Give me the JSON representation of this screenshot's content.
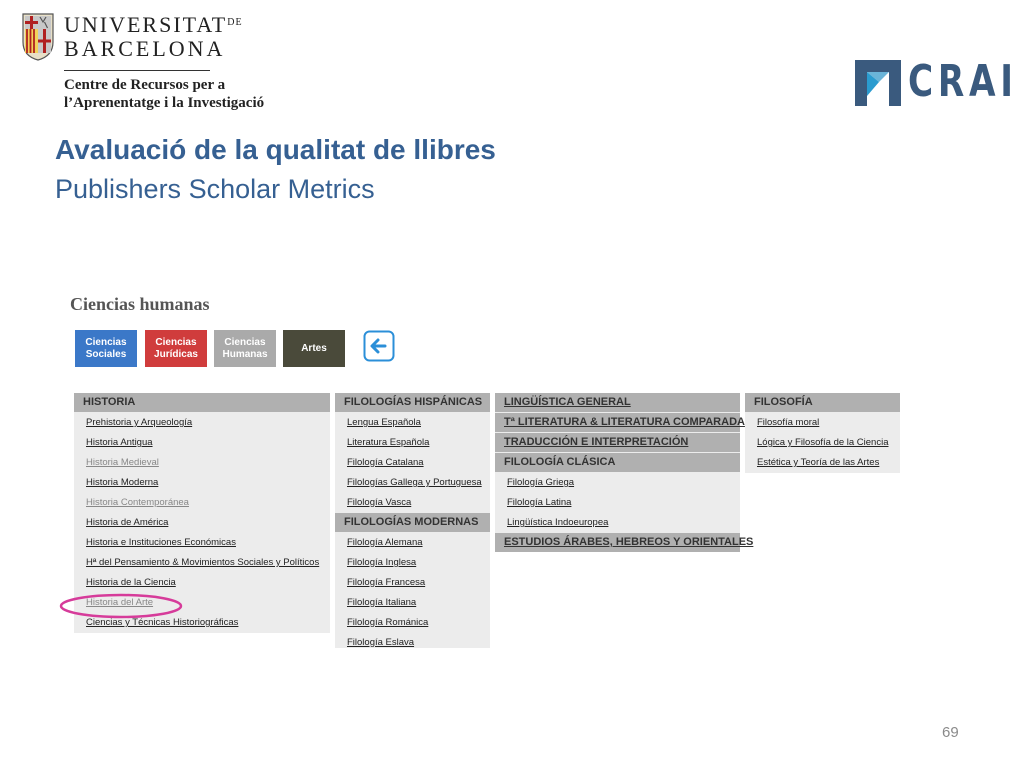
{
  "header": {
    "university_line1_main": "UNIVERSITAT",
    "university_line1_suffix": "DE",
    "university_line2": "BARCELONA",
    "crai_line1": "Centre de Recursos per a",
    "crai_line2": "l’Aprenentatge i la Investigació",
    "crai_logo_text": "CRAI"
  },
  "slide": {
    "title": "Avaluació de la qualitat de llibres",
    "subtitle": "Publishers Scholar Metrics",
    "page_number": "69"
  },
  "colors": {
    "title_blue": "#366092",
    "crai_blue": "#3a5a7e",
    "btn_sociales": "#3b78c8",
    "btn_juridicas": "#d03c3c",
    "btn_humanas": "#aaaaaa",
    "btn_artes": "#4a4a3a",
    "highlight": "#d63b9a"
  },
  "screen": {
    "section_title": "Ciencias humanas",
    "buttons": {
      "sociales": "Ciencias Sociales",
      "juridicas": "Ciencias Jurídicas",
      "humanas": "Ciencias Humanas",
      "artes": "Artes"
    },
    "back_icon": "arrow-left-icon",
    "col1": {
      "head": "HISTORIA",
      "items": [
        "Prehistoria y Arqueología",
        "Historia Antigua",
        "Historia Medieval",
        "Historia Moderna",
        "Historia Contemporánea",
        "Historia de América",
        "Historia e Instituciones Económicas",
        "Hª del Pensamiento & Movimientos Sociales y Políticos",
        "Historia de la Ciencia",
        "Historia del Arte",
        "Ciencias y Técnicas Historiográficas"
      ]
    },
    "col2": {
      "head1": "FILOLOGÍAS HISPÁNICAS",
      "items1": [
        "Lengua Española",
        "Literatura Española",
        "Filología Catalana",
        "Filologías Gallega y Portuguesa",
        "Filología Vasca"
      ],
      "head2": "FILOLOGÍAS MODERNAS",
      "items2": [
        "Filología Alemana",
        "Filología Inglesa",
        "Filología Francesa",
        "Filología Italiana",
        "Filología Románica",
        "Filología Eslava"
      ]
    },
    "col3": {
      "head1": "LINGÜÍSTICA GENERAL",
      "head2": "Tª LITERATURA & LITERATURA COMPARADA",
      "head3": "TRADUCCIÓN E INTERPRETACIÓN",
      "head4": "FILOLOGÍA CLÁSICA",
      "items4": [
        "Filología Griega",
        "Filología Latina",
        "Lingüística Indoeuropea"
      ],
      "head5": "ESTUDIOS ÁRABES, HEBREOS Y ORIENTALES"
    },
    "col4": {
      "head": "FILOSOFÍA",
      "items": [
        "Filosofía moral",
        "Lógica y Filosofía de la Ciencia",
        "Estética y Teoría de las Artes"
      ]
    }
  }
}
